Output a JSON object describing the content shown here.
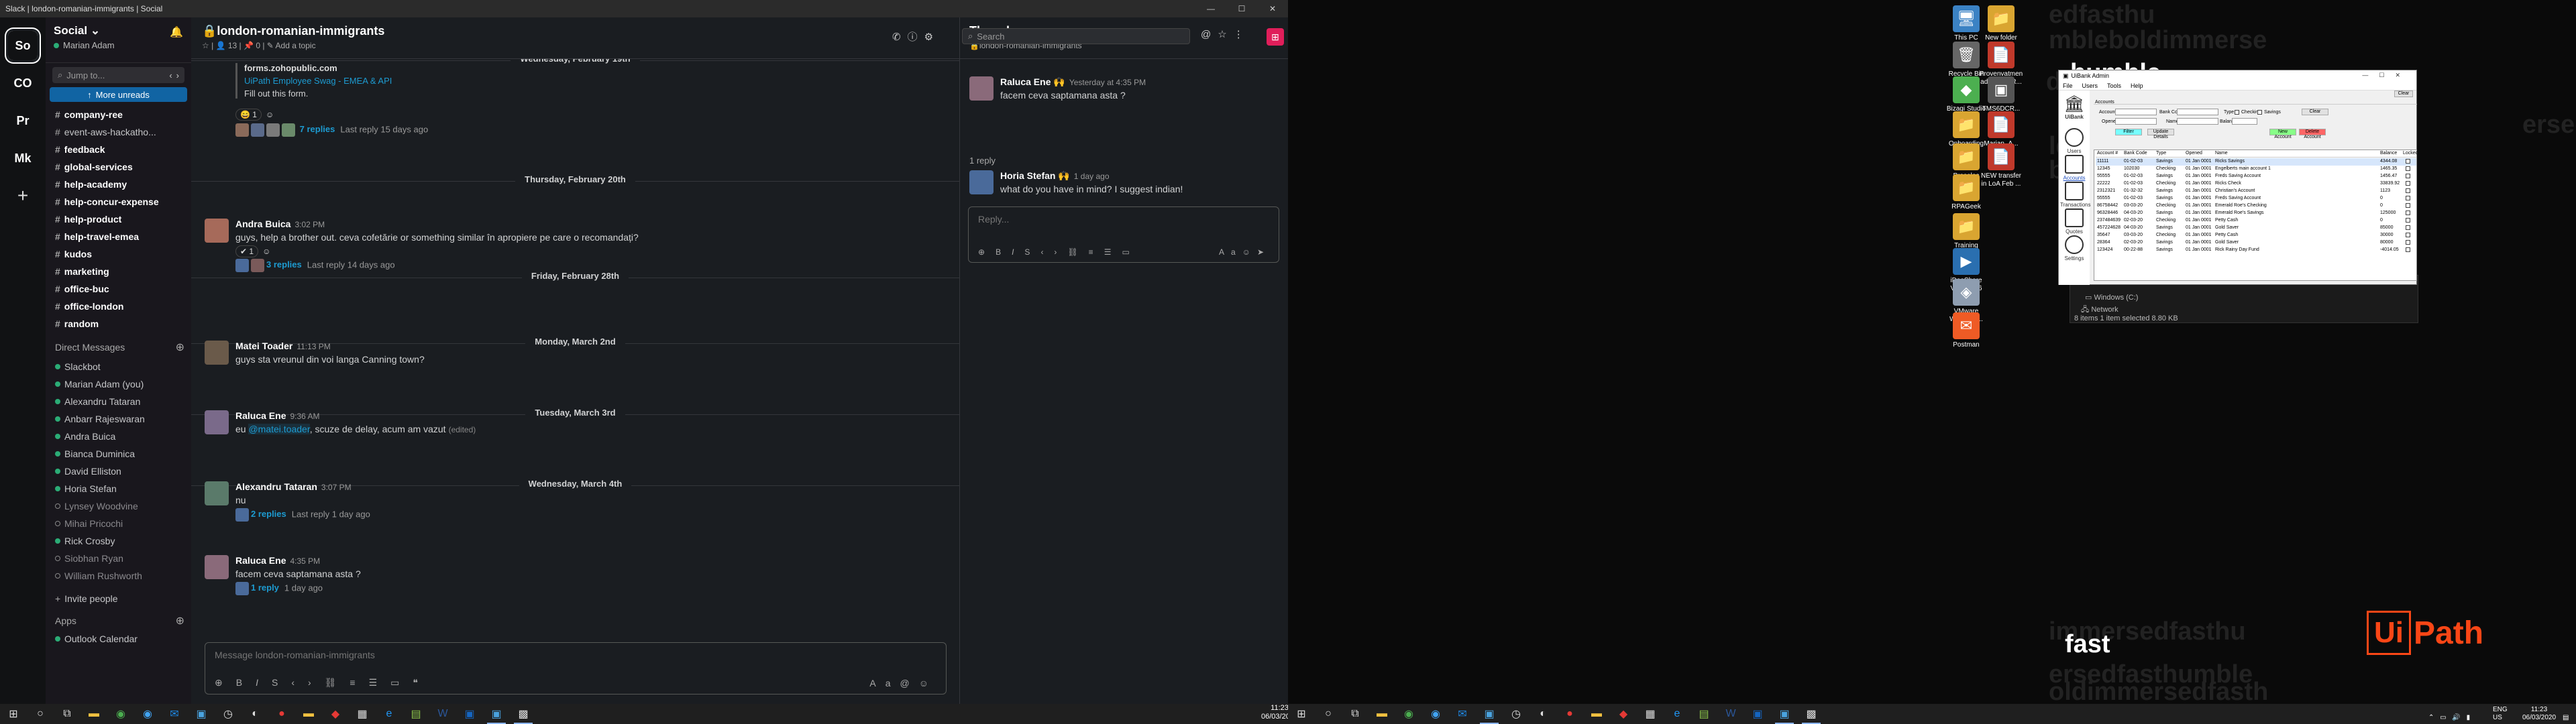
{
  "slack": {
    "window_title": "Slack | london-romanian-immigrants | Social",
    "workspaces": [
      {
        "initials": "So",
        "color": "#e01e5a"
      },
      {
        "initials": "CO",
        "color": "#1264a3"
      },
      {
        "initials": "Pr",
        "color": "#1f70c1"
      },
      {
        "initials": "Mk",
        "color": "#0d72b8"
      }
    ],
    "sidebar": {
      "workspace_name": "Social",
      "user_name": "Marian Adam",
      "jump_placeholder": "Jump to...",
      "more_unreads": "More unreads",
      "channels": [
        {
          "name": "company-ree",
          "bold": true
        },
        {
          "name": "event-aws-hackatho...",
          "bold": false
        },
        {
          "name": "feedback",
          "bold": true
        },
        {
          "name": "global-services",
          "bold": true
        },
        {
          "name": "help-academy",
          "bold": true
        },
        {
          "name": "help-concur-expense",
          "bold": true
        },
        {
          "name": "help-product",
          "bold": true
        },
        {
          "name": "help-travel-emea",
          "bold": true
        },
        {
          "name": "kudos",
          "bold": true
        },
        {
          "name": "marketing",
          "bold": true
        },
        {
          "name": "office-buc",
          "bold": true
        },
        {
          "name": "office-london",
          "bold": true
        },
        {
          "name": "random",
          "bold": true
        }
      ],
      "dm_header": "Direct Messages",
      "dms": [
        {
          "name": "Slackbot",
          "online": true,
          "dim": false
        },
        {
          "name": "Marian Adam (you)",
          "online": true,
          "dim": false
        },
        {
          "name": "Alexandru Tataran",
          "online": true,
          "dim": false
        },
        {
          "name": "Anbarr Rajeswaran",
          "online": true,
          "dim": false
        },
        {
          "name": "Andra Buica",
          "online": true,
          "dim": false
        },
        {
          "name": "Bianca Duminica",
          "online": true,
          "dim": false
        },
        {
          "name": "David Elliston",
          "online": true,
          "dim": false
        },
        {
          "name": "Horia Stefan",
          "online": true,
          "dim": false
        },
        {
          "name": "Lynsey Woodvine",
          "online": false,
          "dim": true
        },
        {
          "name": "Mihai Pricochi",
          "online": false,
          "dim": true
        },
        {
          "name": "Rick Crosby",
          "online": true,
          "dim": false
        },
        {
          "name": "Siobhan Ryan",
          "online": false,
          "dim": true
        },
        {
          "name": "William Rushworth",
          "online": false,
          "dim": true
        }
      ],
      "invite_people": "Invite people",
      "apps_header": "Apps",
      "apps": [
        "Outlook Calendar"
      ]
    },
    "channel": {
      "name": "london-romanian-immigrants",
      "members": "13",
      "pins": "0",
      "add_topic": "Add a topic",
      "search_placeholder": "Search",
      "top_attachment": {
        "domain": "forms.zohopublic.com",
        "title": "UiPath Employee Swag - EMEA & API",
        "text": "Fill out this form."
      },
      "top_thread": {
        "replies": "7 replies",
        "last": "Last reply 15 days ago"
      },
      "dates": {
        "d1": "Wednesday, February 19th",
        "d2": "Thursday, February 20th",
        "d3": "Friday, February 28th",
        "d4": "Monday, March 2nd",
        "d5": "Tuesday, March 3rd",
        "d6": "Wednesday, March 4th"
      },
      "messages": [
        {
          "author": "Andra Buica",
          "time": "3:02 PM",
          "text": "guys, help a brother out. ceva cofetărie or something similar în apropiere pe care o recomandați?",
          "replies": "3 replies",
          "last": "Last reply 14 days ago",
          "react": "1"
        },
        {
          "author": "Matei Toader",
          "time": "11:13 PM",
          "text": "guys sta vreunul din voi langa Canning town?"
        },
        {
          "author": "Raluca Ene",
          "time": "9:36 AM",
          "text_before": "eu ",
          "mention": "@matei.toader",
          "text_after": ", scuze de delay, acum am vazut",
          "edited": "(edited)"
        },
        {
          "author": "Alexandru Tataran",
          "time": "3:07 PM",
          "text": "nu",
          "replies": "2 replies",
          "last": "Last reply 1 day ago"
        },
        {
          "author": "Raluca Ene",
          "time": "4:35 PM",
          "text": "facem ceva saptamana asta ?",
          "replies": "1 reply",
          "last": "1 day ago"
        }
      ],
      "composer_placeholder": "Message london-romanian-immigrants"
    },
    "thread": {
      "title": "Thread",
      "channel": "london-romanian-immigrants",
      "parent": {
        "author": "Raluca Ene",
        "time": "Yesterday at 4:35 PM",
        "text": "facem ceva saptamana asta ?"
      },
      "reply_count": "1 reply",
      "reply": {
        "author": "Horia Stefan",
        "time": "1 day ago",
        "text": "what do you have in mind? I suggest indian!"
      },
      "composer_placeholder": "Reply..."
    }
  },
  "clock_left": {
    "time": "11:23",
    "date": "06/03/2020"
  },
  "desktop": {
    "icons": [
      {
        "label": "This PC",
        "glyph": "🖥",
        "color": "#3b82c4"
      },
      {
        "label": "New folder",
        "glyph": "📁",
        "color": "#d9a531"
      },
      {
        "label": "Recycle Bin",
        "glyph": "🗑",
        "color": "#666"
      },
      {
        "label": "Provenvatmen advanced R...",
        "glyph": "📄",
        "color": "#c0392b"
      },
      {
        "label": "Bizagi Studio",
        "glyph": "◆",
        "color": "#4caf50"
      },
      {
        "label": "TMS6DCR...",
        "glyph": "▣",
        "color": "#555"
      },
      {
        "label": "Onboarding",
        "glyph": "📁",
        "color": "#d9a531"
      },
      {
        "label": "Marian_A...",
        "glyph": "📄",
        "color": "#c0392b"
      },
      {
        "label": "Presales",
        "glyph": "📁",
        "color": "#d9a531"
      },
      {
        "label": "NEW transfer in LoA Feb ...",
        "glyph": "📄",
        "color": "#c0392b"
      },
      {
        "label": "RPAGeek",
        "glyph": "📁",
        "color": "#d9a531"
      },
      {
        "label": "Training",
        "glyph": "📁",
        "color": "#d9a531"
      },
      {
        "label": "iDeaShare VideoGo 6",
        "glyph": "▶",
        "color": "#2a6fb0"
      },
      {
        "label": "VMware Workstati...",
        "glyph": "◈",
        "color": "#8e9db0"
      },
      {
        "label": "Postman",
        "glyph": "✉",
        "color": "#ef5b25"
      }
    ],
    "wallpaper_words": {
      "humble": "humble",
      "fast": "fast",
      "lines": [
        "edfasthu",
        "mbleboldimmerse",
        "dfasthu",
        "ersedf",
        "ldimmersedfasthu",
        "bleboldimmersedf",
        "immersedfasthu",
        "ersedfasthumble",
        "oldimmersedfasth"
      ]
    },
    "logo": {
      "box": "Ui",
      "rest": "Path"
    }
  },
  "uibank": {
    "title": "UiBank Admin",
    "menu": [
      "File",
      "Users",
      "Tools",
      "Help"
    ],
    "brand": "UiBank",
    "nav": [
      "Users",
      "Accounts",
      "Transactions",
      "Quotes",
      "Settings"
    ],
    "clear_top": "Clear",
    "group_label": "Accounts",
    "labels": {
      "account": "Account #",
      "bank_code": "Bank Code",
      "type": "Type",
      "checking": "Checking",
      "savings": "Savings",
      "opened": "Opened",
      "name": "Name",
      "balance": "Balance"
    },
    "buttons": {
      "clear": "Clear",
      "filter": "Filter",
      "update": "Update Details",
      "new": "New Account",
      "delete": "Delete Account"
    },
    "columns": [
      "Account #",
      "Bank Code",
      "Type",
      "Opened",
      "Name",
      "Balance",
      "Locked"
    ],
    "rows": [
      [
        "11111",
        "01-02-03",
        "Savings",
        "01 Jan 0001",
        "Ricks Savings",
        "4344.08"
      ],
      [
        "12345",
        "102030",
        "Checking",
        "01 Jan 0001",
        "Engelberts main account 1",
        "1465.35"
      ],
      [
        "55555",
        "01-02-03",
        "Savings",
        "01 Jan 0001",
        "Freds Saving Account",
        "1456.47"
      ],
      [
        "22222",
        "01-02-03",
        "Checking",
        "01 Jan 0001",
        "Ricks Check",
        "33839.92"
      ],
      [
        "2312321",
        "01-32-32",
        "Savings",
        "01 Jan 0001",
        "Christian's Account",
        "1123"
      ],
      [
        "55555",
        "01-02-03",
        "Savings",
        "01 Jan 0001",
        "Freds Saving Account",
        "0"
      ],
      [
        "86758442",
        "03-03-20",
        "Checking",
        "01 Jan 0001",
        "Emerald Roe's Checking",
        "0"
      ],
      [
        "96328446",
        "04-03-20",
        "Savings",
        "01 Jan 0001",
        "Emerald Roe's Savings",
        "125000"
      ],
      [
        "237484639",
        "02-03-20",
        "Checking",
        "01 Jan 0001",
        "Petty Cash",
        "0"
      ],
      [
        "457224628",
        "04-03-20",
        "Savings",
        "01 Jan 0001",
        "Gold Saver",
        "85000"
      ],
      [
        "35647",
        "03-03-20",
        "Checking",
        "01 Jan 0001",
        "Petty Cash",
        "30000"
      ],
      [
        "28364",
        "02-03-20",
        "Savings",
        "01 Jan 0001",
        "Gold Saver",
        "80000"
      ],
      [
        "123424",
        "00-22-88",
        "Savings",
        "01 Jan 0001",
        "Rick Rainy Day Fund",
        "-4014.05"
      ]
    ]
  },
  "explorer": {
    "network": "Network",
    "drive": "Windows (C:)",
    "status": "8 items   1 item selected  8.80 KB"
  },
  "tray": {
    "lang": "ENG",
    "region": "US",
    "time": "11:23",
    "date": "06/03/2020"
  }
}
